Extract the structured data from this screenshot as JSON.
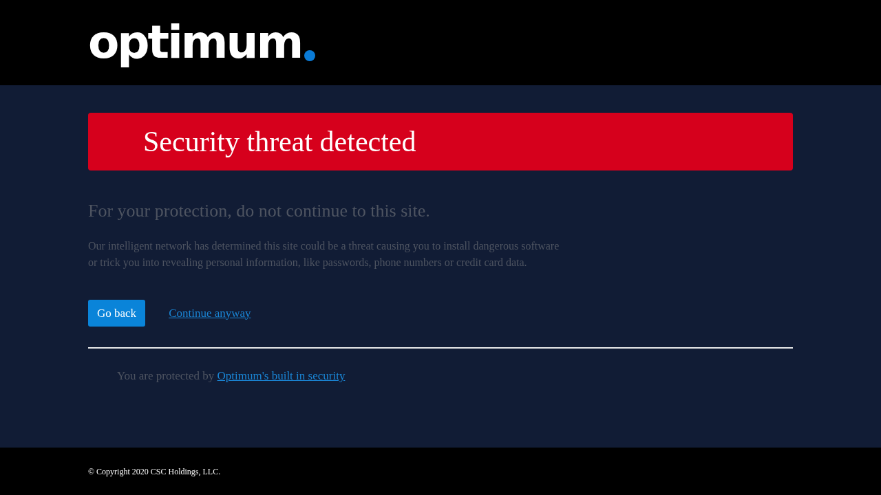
{
  "header": {
    "logo": "optimum"
  },
  "alert": {
    "title": "Security threat detected"
  },
  "heading": "For your protection, do not continue to this site.",
  "description": "Our intelligent network has determined this site could be a threat causing you to install dangerous software or trick you into revealing personal information, like passwords, phone numbers or credit card data.",
  "actions": {
    "primary": "Go back",
    "link": "Continue anyway"
  },
  "protection": {
    "text": "You are protected by",
    "link": "Optimum's built in security"
  },
  "footer": {
    "copyright": "© Copyright 2020 CSC Holdings, LLC."
  }
}
